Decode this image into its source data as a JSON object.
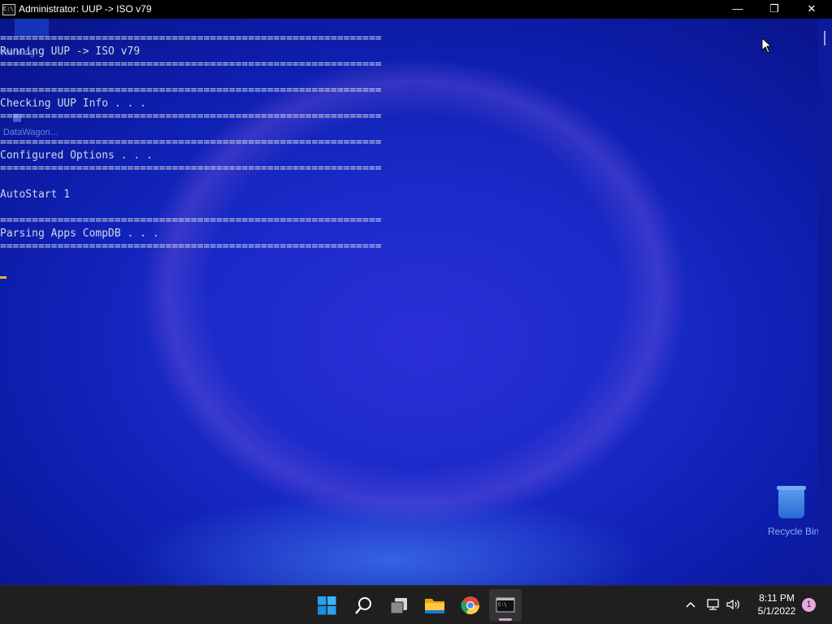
{
  "window": {
    "title": "Administrator:  UUP -> ISO v79",
    "icon_glyph": "C:\\",
    "minimize_glyph": "—",
    "maximize_glyph": "❐",
    "close_glyph": "✕"
  },
  "console": {
    "lines": [
      "============================================================",
      "Running UUP -> ISO v79",
      "============================================================",
      "",
      "============================================================",
      "Checking UUP Info . . .",
      "============================================================",
      "",
      "============================================================",
      "Configured Options . . .",
      "============================================================",
      "",
      "AutoStart 1",
      "",
      "============================================================",
      "Parsing Apps CompDB . . .",
      "============================================================"
    ]
  },
  "desktop": {
    "icon_label_1": "Running",
    "icon_label_2": "DataWagon...",
    "recycle_bin_label": "Recycle Bin"
  },
  "taskbar": {
    "apps": [
      {
        "name": "start-icon"
      },
      {
        "name": "search-icon"
      },
      {
        "name": "task-view-icon"
      },
      {
        "name": "file-explorer-icon"
      },
      {
        "name": "chrome-icon"
      },
      {
        "name": "terminal-icon"
      }
    ],
    "tray": {
      "time": "8:11 PM",
      "date": "5/1/2022",
      "notification_count": "1"
    },
    "colors": {
      "background": "#1f1f1f",
      "active_indicator": "#d7a0c8"
    }
  }
}
